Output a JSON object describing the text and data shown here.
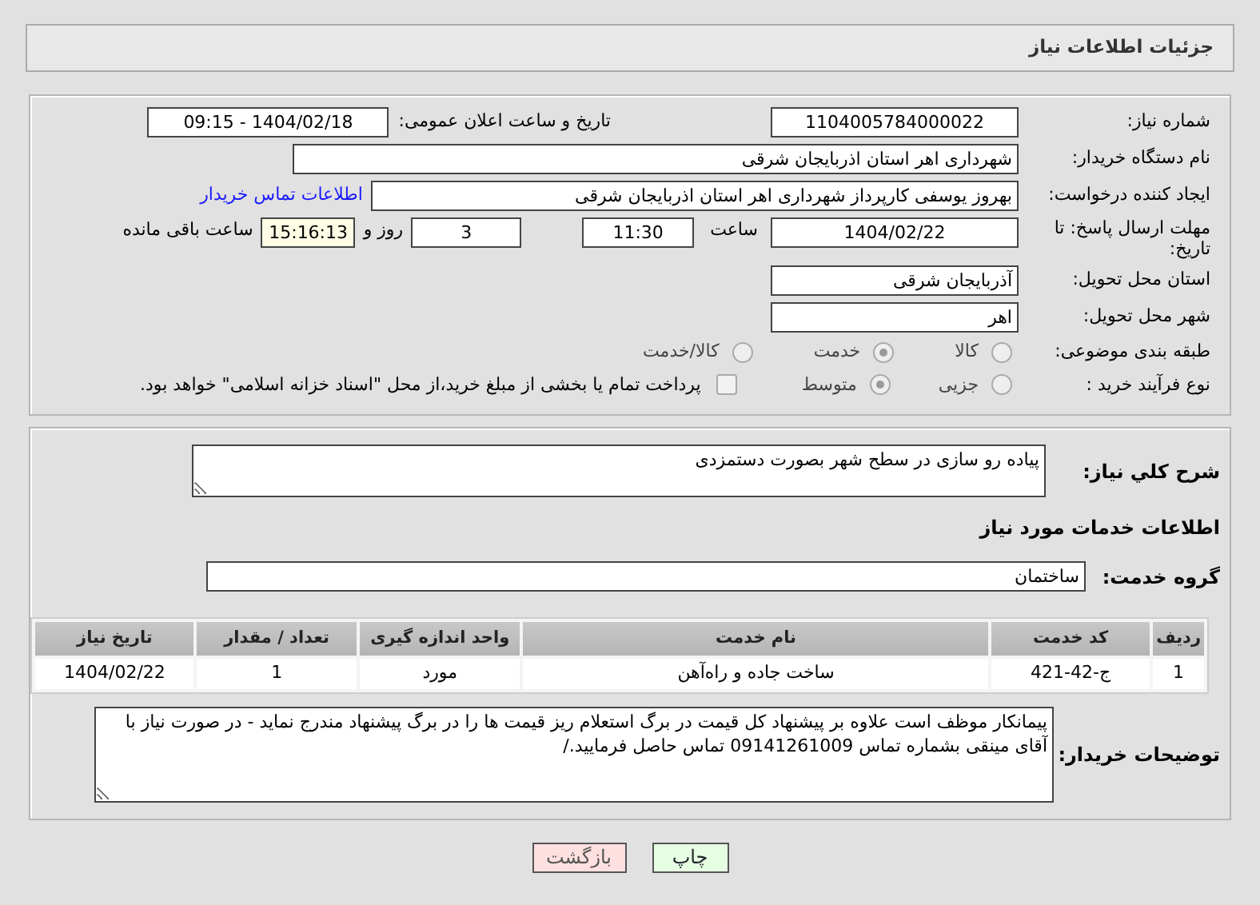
{
  "header": {
    "title": "جزئیات اطلاعات نیاز"
  },
  "details": {
    "need_number": {
      "label": "شماره نیاز:",
      "value": "1104005784000022"
    },
    "announce": {
      "label": "تاریخ و ساعت اعلان عمومی:",
      "value": "1404/02/18 - 09:15"
    },
    "buyer_org": {
      "label": "نام دستگاه خریدار:",
      "value": "شهرداری اهر استان اذربایجان شرقی"
    },
    "requester": {
      "label": "ایجاد کننده درخواست:",
      "value": "بهروز یوسفی کارپرداز شهرداری اهر استان اذربایجان شرقی",
      "link": "اطلاعات تماس خریدار"
    },
    "deadline": {
      "label": "مهلت ارسال پاسخ: تا تاریخ:",
      "date": "1404/02/22",
      "time_label": "ساعت",
      "time": "11:30",
      "days": "3",
      "days_label": "روز و",
      "remaining": "15:16:13",
      "remaining_label": "ساعت باقی مانده"
    },
    "province": {
      "label": "استان محل تحویل:",
      "value": "آذربایجان شرقی"
    },
    "city": {
      "label": "شهر محل تحویل:",
      "value": "اهر"
    },
    "category": {
      "label": "طبقه بندی موضوعی:",
      "options": [
        {
          "label": "کالا",
          "selected": false
        },
        {
          "label": "خدمت",
          "selected": true
        },
        {
          "label": "کالا/خدمت",
          "selected": false
        }
      ]
    },
    "process": {
      "label": "نوع فرآیند خرید :",
      "options": [
        {
          "label": "جزیی",
          "selected": false
        },
        {
          "label": "متوسط",
          "selected": true
        }
      ],
      "payment": {
        "label": "پرداخت تمام یا بخشی از مبلغ خرید،از محل \"اسناد خزانه اسلامی\" خواهد بود.",
        "checked": false
      }
    }
  },
  "need": {
    "description": {
      "label": "شرح کلي نياز:",
      "value": "پیاده رو سازی در سطح شهر بصورت دستمزدی"
    },
    "section_title": "اطلاعات خدمات مورد نیاز",
    "service_group": {
      "label": "گروه خدمت:",
      "value": "ساختمان"
    },
    "table": {
      "columns": [
        "ردیف",
        "کد خدمت",
        "نام خدمت",
        "واحد اندازه گیری",
        "تعداد / مقدار",
        "تاریخ نیاز"
      ],
      "rows": [
        [
          "1",
          "ج-42-421",
          "ساخت جاده و راه‌آهن",
          "مورد",
          "1",
          "1404/02/22"
        ]
      ]
    },
    "buyer_notes": {
      "label": "توضیحات خریدار:",
      "value": "پیمانکار موظف است علاوه بر پیشنهاد کل قیمت در برگ استعلام ریز قیمت ها را در برگ پیشنهاد مندرج نماید - در صورت نیاز با آقای مینقی بشماره تماس 09141261009 تماس حاصل فرمایید./"
    }
  },
  "buttons": [
    {
      "kind": "print",
      "label": "چاپ"
    },
    {
      "kind": "back",
      "label": "بازگشت"
    }
  ]
}
